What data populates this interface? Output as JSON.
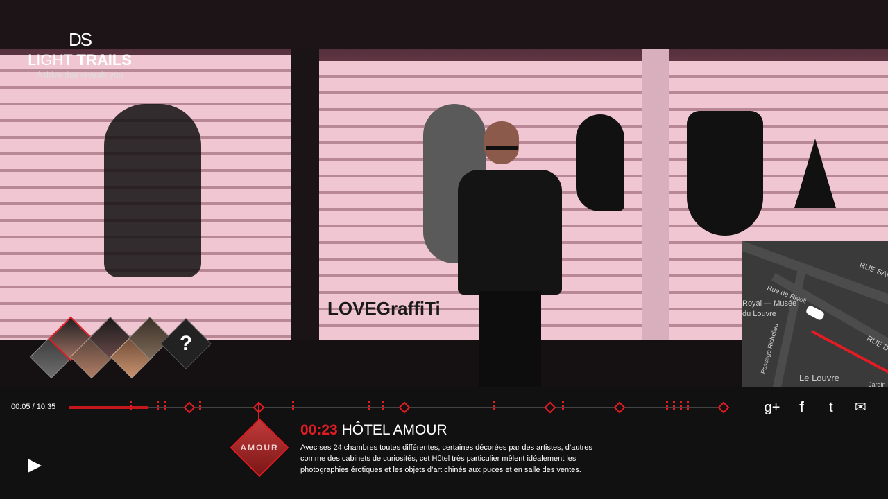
{
  "brand": {
    "logo_text": "DS",
    "title_light": "LIGHT",
    "title_bold": "TRAILS",
    "tagline": "A drive that reveals you"
  },
  "hero": {
    "graffiti_text": "LOVEGraffiTi"
  },
  "characters": {
    "help_label": "?"
  },
  "map": {
    "labels": [
      "RUE SAI",
      "Rue de Rivoli",
      "Royal — Musée",
      "du Louvre",
      "Passage Richelieu",
      "Le Louvre",
      "RUE D",
      "Jardin"
    ]
  },
  "player": {
    "timecode": "00:05 / 10:35",
    "progress_fraction": 0.12,
    "play_icon": "play-icon"
  },
  "share": {
    "items": [
      {
        "label": "g+",
        "icon": "google-plus-icon"
      },
      {
        "label": "f",
        "icon": "facebook-icon"
      },
      {
        "label": "t",
        "icon": "twitter-icon"
      },
      {
        "label": "✉",
        "icon": "mail-icon"
      }
    ]
  },
  "chapter": {
    "time": "00:23",
    "title": "HÔTEL AMOUR",
    "thumb_text": "AMOUR",
    "description": "Avec ses 24 chambres toutes différentes, certaines décorées par des artistes, d’autres comme des cabinets de curiosités, cet Hôtel très particulier mêlent idéalement les photographies érotiques et les objets d’art chinés aux puces et en salle des ventes."
  },
  "colors": {
    "accent": "#e31b23",
    "background": "#111111"
  }
}
